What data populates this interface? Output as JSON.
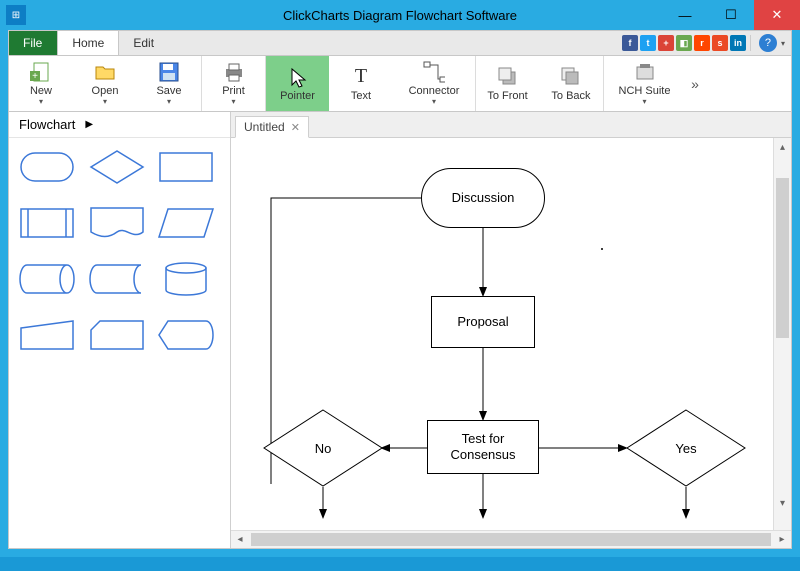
{
  "window": {
    "title": "ClickCharts Diagram Flowchart Software"
  },
  "menubar": {
    "file": "File",
    "home": "Home",
    "edit": "Edit"
  },
  "ribbon": {
    "new": "New",
    "open": "Open",
    "save": "Save",
    "print": "Print",
    "pointer": "Pointer",
    "text": "Text",
    "connector": "Connector",
    "tofront": "To Front",
    "toback": "To Back",
    "nchsuite": "NCH Suite"
  },
  "sidebar": {
    "category": "Flowchart",
    "shapes": [
      "terminator",
      "decision",
      "process",
      "predefined-process",
      "document",
      "data",
      "direct-data",
      "stored-data",
      "database",
      "manual-input",
      "card",
      "display"
    ]
  },
  "tabs": {
    "untitled": "Untitled"
  },
  "flowchart": {
    "nodes": {
      "discussion": "Discussion",
      "proposal": "Proposal",
      "consensus": "Test for\nConsensus",
      "no": "No",
      "yes": "Yes"
    }
  },
  "social_icons": [
    "facebook",
    "twitter",
    "google-plus",
    "digg",
    "reddit",
    "stumbleupon",
    "linkedin"
  ]
}
